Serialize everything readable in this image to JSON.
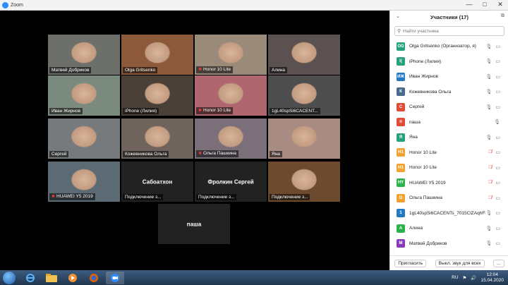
{
  "window": {
    "title": "Zoom",
    "controls": [
      "—",
      "□",
      "✕"
    ]
  },
  "tiles": [
    {
      "name": "Матвей Добриков",
      "muted": false,
      "style": "photo",
      "bg": "#6d6f6a"
    },
    {
      "name": "Olga Gritsenko",
      "muted": false,
      "style": "photo",
      "bg": "#8c5a3a"
    },
    {
      "name": "Honor 10 Lite",
      "muted": true,
      "style": "photo",
      "bg": "#9a8a7a"
    },
    {
      "name": "Алина",
      "muted": false,
      "style": "photo",
      "bg": "#5a5150"
    },
    {
      "name": "Иван Жирнов",
      "muted": false,
      "style": "photo",
      "bg": "#7a8a7e",
      "active": true
    },
    {
      "name": "iPhone (Лилия)",
      "muted": false,
      "style": "photo",
      "bg": "#4a4038"
    },
    {
      "name": "Honor 10 Lite",
      "muted": true,
      "style": "photo",
      "bg": "#b0666f"
    },
    {
      "name": "1gL40spSi6CACENT...",
      "muted": false,
      "style": "photo",
      "bg": "#4e4e4e"
    },
    {
      "name": "Сергей",
      "muted": false,
      "style": "photo",
      "bg": "#777a7c"
    },
    {
      "name": "Кожевникова Ольга",
      "muted": false,
      "style": "photo",
      "bg": "#6e645d"
    },
    {
      "name": "Ольга Пашкина",
      "muted": true,
      "style": "photo",
      "bg": "#7b6f7a"
    },
    {
      "name": "Яна",
      "muted": false,
      "style": "photo",
      "bg": "#a88c83"
    },
    {
      "name": "HUAWEI Y5 2019",
      "muted": true,
      "style": "photo",
      "bg": "#5c6a74"
    },
    {
      "name": "Подключение з...",
      "muted": false,
      "style": "name",
      "center": "Сабоатхон"
    },
    {
      "name": "Подключение з...",
      "muted": false,
      "style": "name",
      "center": "Фролкин Сергей"
    },
    {
      "name": "Подключение з...",
      "muted": false,
      "style": "photo",
      "bg": "#6b4a2e"
    },
    {
      "name": "",
      "muted": false,
      "style": "name",
      "center": "паша"
    }
  ],
  "panel": {
    "title": "Участники (17)",
    "search_placeholder": "Найти участника",
    "participants": [
      {
        "initials": "OG",
        "color": "#26a17b",
        "name": "Olga Gritsenko (Организатор, я)",
        "mic": "on",
        "cam": "on"
      },
      {
        "initials": "I(",
        "color": "#26a17b",
        "name": "iPhone (Лилия)",
        "mic": "on",
        "cam": "on"
      },
      {
        "initials": "ИЖ",
        "color": "#2479c2",
        "name": "Иван Жирнов",
        "mic": "on",
        "cam": "on"
      },
      {
        "initials": "К",
        "color": "#486b8c",
        "name": "Кожевникова Ольга",
        "mic": "on",
        "cam": "on"
      },
      {
        "initials": "С",
        "color": "#e04b3a",
        "name": "Сергей",
        "mic": "on",
        "cam": "on"
      },
      {
        "initials": "п",
        "color": "#e04b3a",
        "name": "паша",
        "mic": "on",
        "cam": "none"
      },
      {
        "initials": "Я",
        "color": "#26a17b",
        "name": "Яна",
        "mic": "on",
        "cam": "on"
      },
      {
        "initials": "H1",
        "color": "#f0a330",
        "name": "Honor 10 Lite",
        "mic": "muted",
        "cam": "on"
      },
      {
        "initials": "H1",
        "color": "#f0a330",
        "name": "Honor 10 Lite",
        "mic": "muted",
        "cam": "on"
      },
      {
        "initials": "HY",
        "color": "#2bb24c",
        "name": "HUAWEI Y5 2019",
        "mic": "muted",
        "cam": "on"
      },
      {
        "initials": "О",
        "color": "#f0a330",
        "name": "Ольга Пашкина",
        "mic": "muted",
        "cam": "on"
      },
      {
        "initials": "1",
        "color": "#2479c2",
        "name": "1gL40spSi6CACENTs_7015ClZAqhFB...",
        "mic": "on",
        "cam": "on"
      },
      {
        "initials": "А",
        "color": "#2bb24c",
        "name": "Алина",
        "mic": "on",
        "cam": "on"
      },
      {
        "initials": "М",
        "color": "#8a3ab9",
        "name": "Матвей Добриков",
        "mic": "on",
        "cam": "on"
      }
    ],
    "footer": {
      "invite": "Пригласить",
      "mute_all": "Выкл. звук для всех",
      "more": "..."
    }
  },
  "taskbar": {
    "lang": "RU",
    "time": "12:04",
    "date": "15.04.2020"
  }
}
